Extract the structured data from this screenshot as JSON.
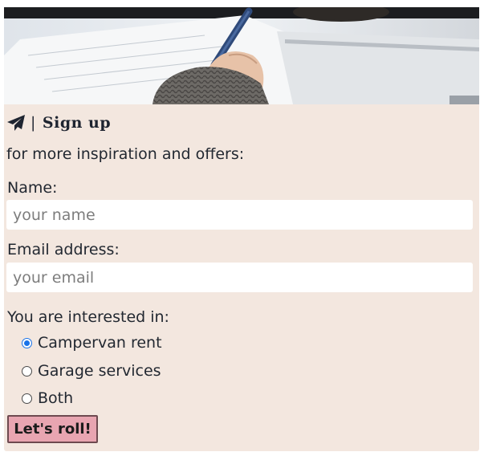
{
  "heading": {
    "separator": "|",
    "title": "Sign up",
    "icon": "paper-plane-icon"
  },
  "subtitle": "for more inspiration and offers:",
  "name_field": {
    "label": "Name:",
    "placeholder": "your name",
    "value": ""
  },
  "email_field": {
    "label": "Email address:",
    "placeholder": "your email",
    "value": ""
  },
  "interest": {
    "label": "You are interested in:",
    "options": [
      {
        "label": "Campervan rent",
        "checked": true
      },
      {
        "label": "Garage services",
        "checked": false
      },
      {
        "label": "Both",
        "checked": false
      }
    ]
  },
  "submit_label": "Let's roll!",
  "colors": {
    "panel_background": "#f3e7df",
    "button_background": "#e8a5b1",
    "radio_accent": "#1a73e8"
  }
}
